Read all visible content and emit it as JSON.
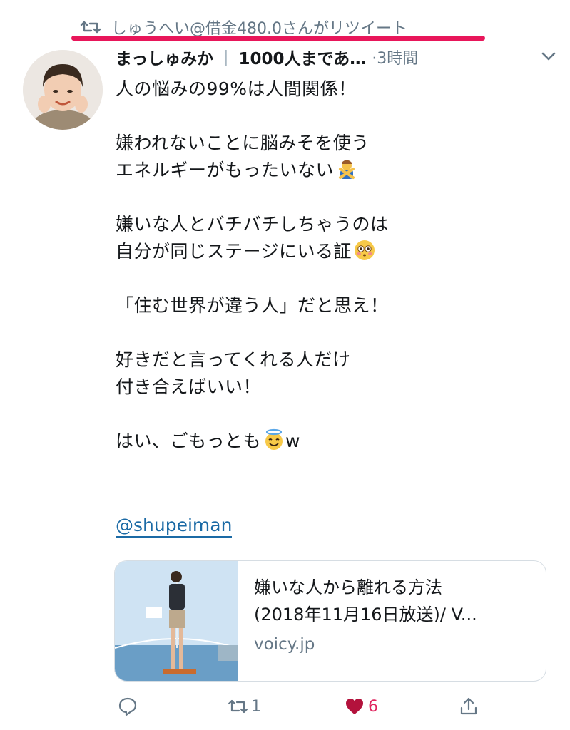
{
  "retweet": {
    "text": "しゅうへい@借金480.0さんがリツイート",
    "icon": "retweet-icon"
  },
  "tweet": {
    "display_name": "まっしゅみか",
    "separator": "|",
    "bio_truncated": "1000人まであ…",
    "time": "·3時間",
    "lines": [
      "人の悩みの99%は人間関係！",
      "嫌われないことに脳みそを使う",
      "エネルギーがもったいない",
      "嫌いな人とバチバチしちゃうのは",
      "自分が同じステージにいる証",
      "「住む世界が違う人」だと思え！",
      "好きだと言ってくれる人だけ",
      "付き合えばいい！",
      "はい、ごもっとも",
      "w"
    ],
    "mention": "@shupeiman"
  },
  "card": {
    "title": "嫌いな人から離れる方法",
    "subtitle": "(2018年11月16日放送)/ V...",
    "domain": "voicy.jp"
  },
  "actions": {
    "reply_count": "",
    "retweet_count": "1",
    "like_count": "6",
    "liked": true
  },
  "colors": {
    "accent_underline": "#e8165a",
    "link": "#1b6aa5",
    "like": "#e0245e",
    "muted": "#657786"
  }
}
